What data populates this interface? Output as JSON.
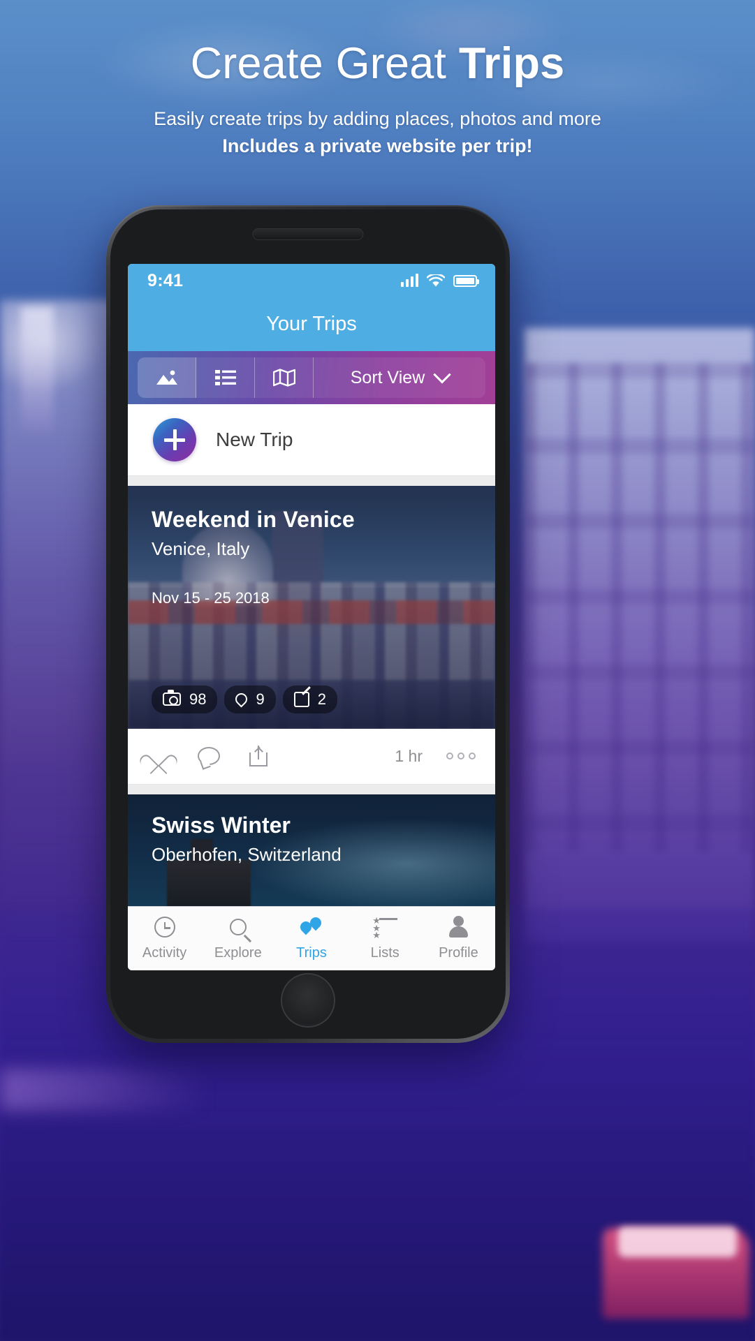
{
  "promo": {
    "headline_light": "Create Great ",
    "headline_bold": "Trips",
    "subtitle_line1": "Easily create trips by adding places, photos and more",
    "subtitle_line2": "Includes a private website per trip!"
  },
  "status_bar": {
    "time": "9:41",
    "signal_icon": "signal-bars-icon",
    "wifi_icon": "wifi-icon",
    "battery_icon": "battery-icon"
  },
  "navbar": {
    "title": "Your Trips"
  },
  "toolbar": {
    "segments": [
      {
        "name": "photo-view",
        "icon": "photo-mountain-icon",
        "active": true
      },
      {
        "name": "list-view",
        "icon": "list-icon",
        "active": false
      },
      {
        "name": "map-view",
        "icon": "map-icon",
        "active": false
      }
    ],
    "sort_label": "Sort View",
    "sort_chevron": "chevron-down-icon"
  },
  "new_trip": {
    "label": "New Trip",
    "icon": "plus-icon"
  },
  "trips": [
    {
      "title": "Weekend in Venice",
      "location": "Venice, Italy",
      "dates": "Nov 15 - 25 2018",
      "stats": [
        {
          "icon": "camera-icon",
          "value": "98"
        },
        {
          "icon": "map-pin-icon",
          "value": "9"
        },
        {
          "icon": "note-edit-icon",
          "value": "2"
        }
      ],
      "actions": {
        "like_icon": "heart-icon",
        "comment_icon": "comment-bubble-icon",
        "share_icon": "share-icon",
        "time": "1 hr",
        "more_icon": "more-dots-icon"
      }
    },
    {
      "title": "Swiss Winter",
      "location": "Oberhofen, Switzerland"
    }
  ],
  "tabbar": {
    "items": [
      {
        "label": "Activity",
        "icon": "clock-icon",
        "active": false
      },
      {
        "label": "Explore",
        "icon": "search-icon",
        "active": false
      },
      {
        "label": "Trips",
        "icon": "map-pins-icon",
        "active": true
      },
      {
        "label": "Lists",
        "icon": "star-list-icon",
        "active": false
      },
      {
        "label": "Profile",
        "icon": "person-icon",
        "active": false
      }
    ]
  },
  "colors": {
    "accent_blue": "#4eaee4",
    "tab_active": "#2fa4e7",
    "toolbar_start": "#4b68b0",
    "toolbar_end": "#a23f96"
  }
}
